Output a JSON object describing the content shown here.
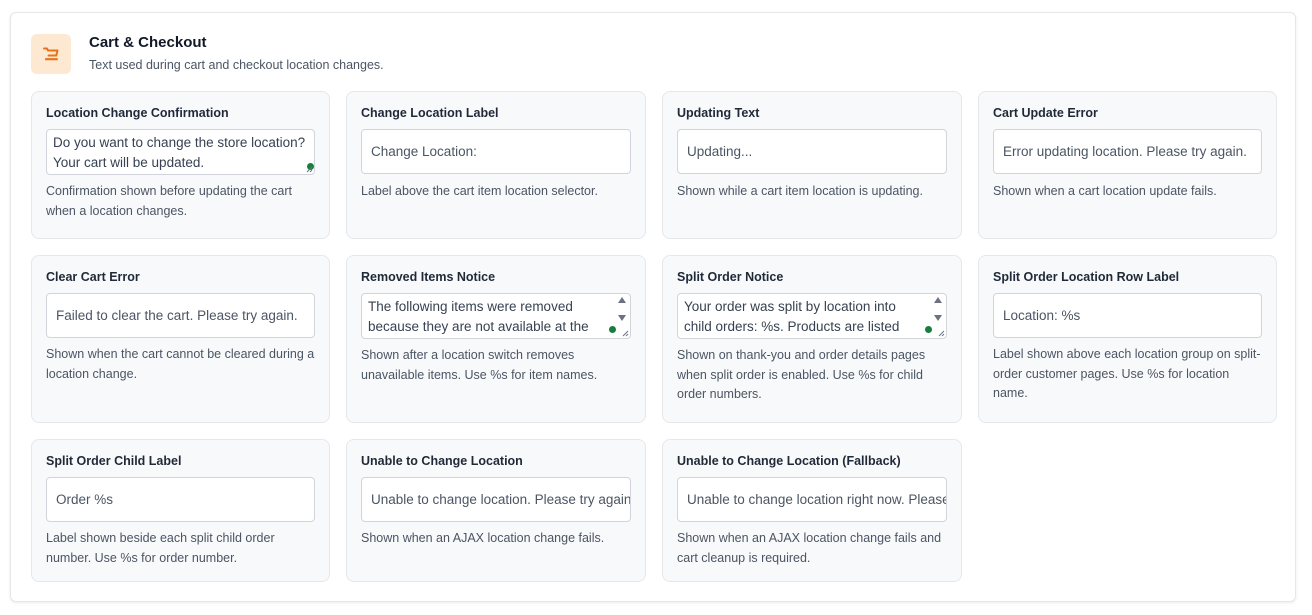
{
  "section": {
    "icon": "cart-icon",
    "title": "Cart & Checkout",
    "description": "Text used during cart and checkout location changes."
  },
  "colors": {
    "icon_bg": "#fde8d2",
    "icon_fg": "#e8731a",
    "card_bg": "#f8f9fb",
    "status_dot": "#15803d"
  },
  "fields": [
    {
      "label": "Location Change Confirmation",
      "value": "Do you want to change the store location? Your cart will be updated.",
      "help": "Confirmation shown before updating the cart when a location changes."
    },
    {
      "label": "Change Location Label",
      "value": "Change Location:",
      "help": "Label above the cart item location selector."
    },
    {
      "label": "Updating Text",
      "value": "Updating...",
      "help": "Shown while a cart item location is updating."
    },
    {
      "label": "Cart Update Error",
      "value": "Error updating location. Please try again.",
      "help": "Shown when a cart location update fails."
    },
    {
      "label": "Clear Cart Error",
      "value": "Failed to clear the cart. Please try again.",
      "help": "Shown when the cart cannot be cleared during a location change."
    },
    {
      "label": "Removed Items Notice",
      "value": "The following items were removed because they are not available at the",
      "help": "Shown after a location switch removes unavailable items. Use %s for item names."
    },
    {
      "label": "Split Order Notice",
      "value": "Your order was split by location into child orders: %s. Products are listed",
      "help": "Shown on thank-you and order details pages when split order is enabled. Use %s for child order numbers."
    },
    {
      "label": "Split Order Location Row Label",
      "value": "Location: %s",
      "help": "Label shown above each location group on split-order customer pages. Use %s for location name."
    },
    {
      "label": "Split Order Child Label",
      "value": "Order %s",
      "help": "Label shown beside each split child order number. Use %s for order number."
    },
    {
      "label": "Unable to Change Location",
      "value": "Unable to change location. Please try again.",
      "help": "Shown when an AJAX location change fails."
    },
    {
      "label": "Unable to Change Location (Fallback)",
      "value": "Unable to change location right now. Please try again.",
      "help": "Shown when an AJAX location change fails and cart cleanup is required."
    }
  ]
}
